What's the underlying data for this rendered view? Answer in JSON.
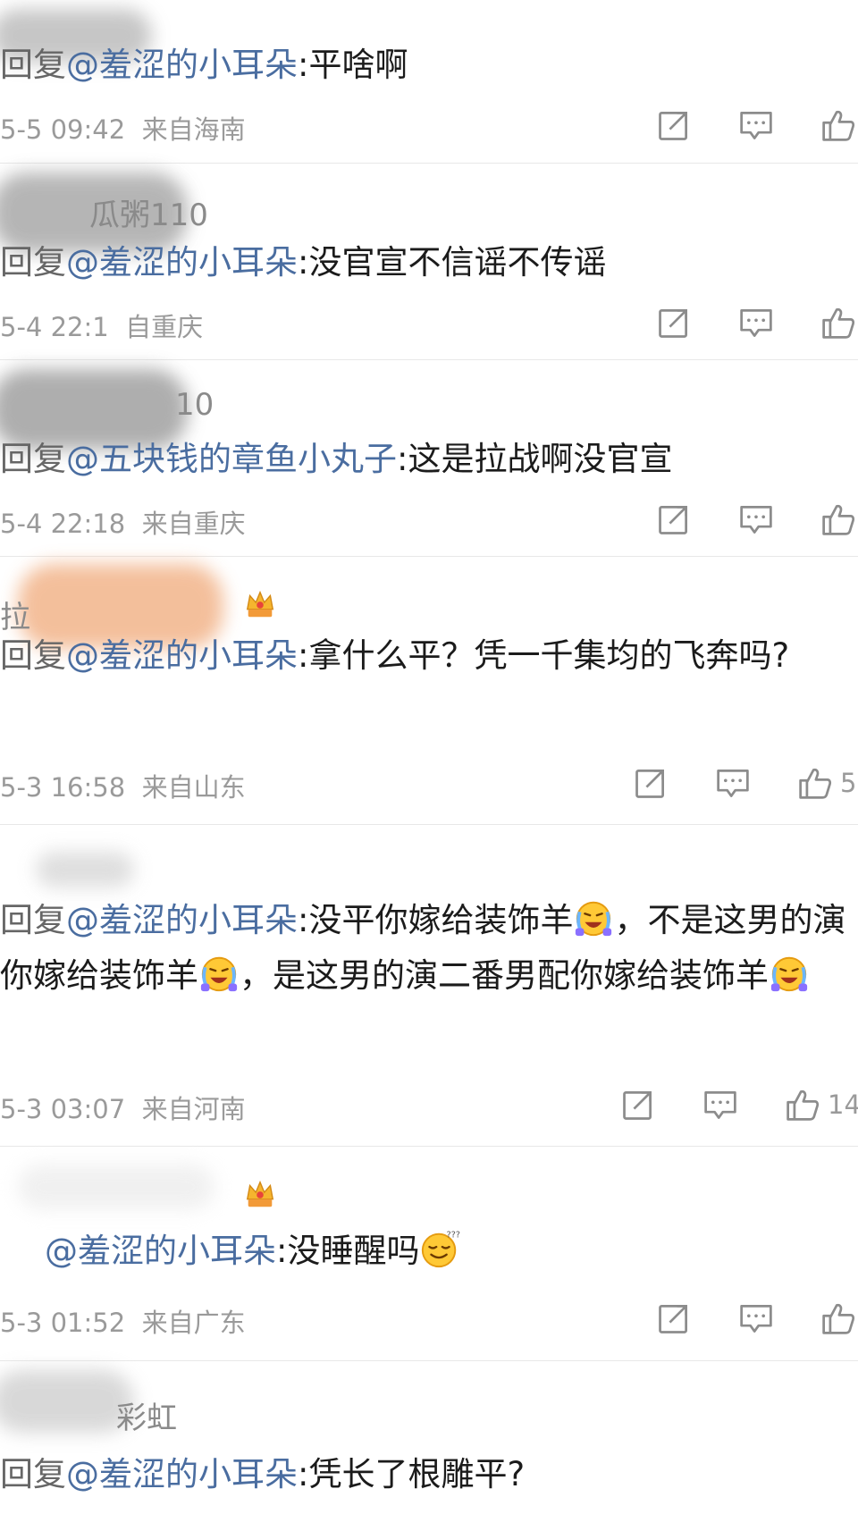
{
  "comments": [
    {
      "username": "",
      "reply_prefix": "回复",
      "mention": "@羞涩的小耳朵",
      "text": ":平啥啊",
      "time": "5-5 09:42",
      "location": "来自海南",
      "like_count": ""
    },
    {
      "username": "瓜粥110",
      "reply_prefix": "回复",
      "mention": "@羞涩的小耳朵",
      "text": ":没官宣不信谣不传谣",
      "time": "5-4 22:1",
      "location": "自重庆",
      "like_count": ""
    },
    {
      "username": "10",
      "reply_prefix": "回复",
      "mention": "@五块钱的章鱼小丸子",
      "text": ":这是拉战啊没官宣",
      "time": "5-4 22:18",
      "location": "来自重庆",
      "like_count": ""
    },
    {
      "username": "拉",
      "reply_prefix": "回复",
      "mention": "@羞涩的小耳朵",
      "text": ":拿什么平？凭一千集均的飞奔吗?",
      "time": "5-3 16:58",
      "location": "来自山东",
      "like_count": "5"
    },
    {
      "username": "",
      "reply_prefix": "回复",
      "mention": "@羞涩的小耳朵",
      "text_parts": [
        ":没平你嫁给装饰羊",
        "，不是这男的演你嫁给装饰羊",
        "，是这男的演二番男配你嫁给装饰羊"
      ],
      "time": "5-3 03:07",
      "location": "来自河南",
      "like_count": "14"
    },
    {
      "username": "",
      "reply_prefix": "",
      "mention": "@羞涩的小耳朵",
      "text": ":没睡醒吗",
      "time": "5-3 01:52",
      "location": "来自广东",
      "like_count": ""
    },
    {
      "username": "彩虹",
      "reply_prefix": "回复",
      "mention": "@羞涩的小耳朵",
      "text": ":凭长了根雕平?",
      "time": "",
      "location": "",
      "like_count": ""
    }
  ],
  "icons": {
    "share": "share-icon",
    "comment": "comment-icon",
    "like": "thumbs-up-icon",
    "crown": "crown-badge-icon",
    "laugh_cry": "laughing-crying-emoji",
    "sleepy": "sleepy-dizzy-emoji"
  },
  "colors": {
    "mention": "#4a6da0",
    "meta": "#9a9a9a",
    "text": "#1b1b1b"
  }
}
